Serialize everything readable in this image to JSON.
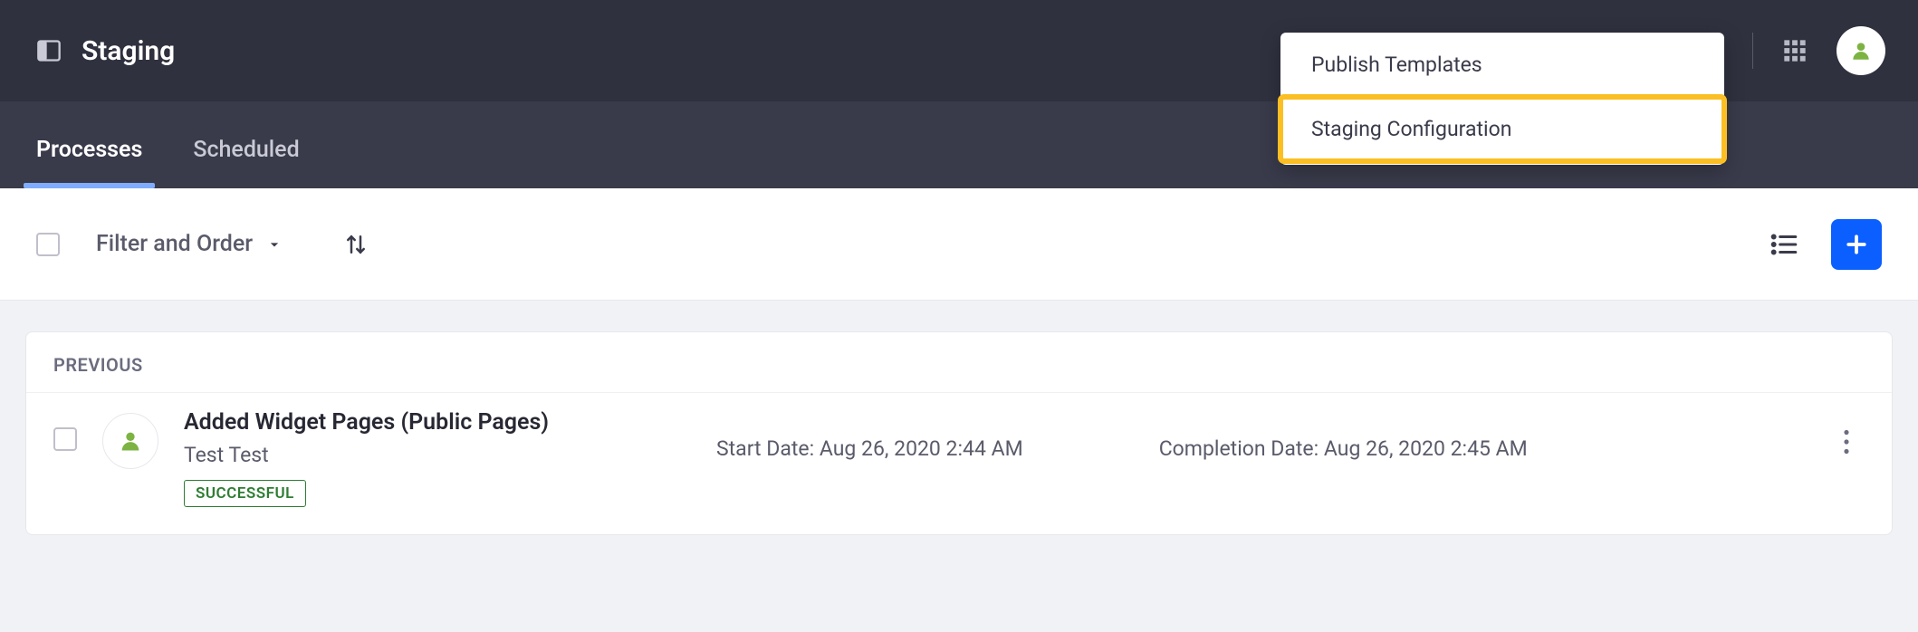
{
  "header": {
    "title": "Staging"
  },
  "dropdown": {
    "items": [
      {
        "label": "Publish Templates",
        "highlighted": false
      },
      {
        "label": "Staging Configuration",
        "highlighted": true
      }
    ]
  },
  "tabs": [
    {
      "label": "Processes",
      "active": true
    },
    {
      "label": "Scheduled",
      "active": false
    }
  ],
  "toolbar": {
    "filter_label": "Filter and Order"
  },
  "panel": {
    "header": "PREVIOUS",
    "rows": [
      {
        "title": "Added Widget Pages (Public Pages)",
        "author": "Test Test",
        "status": "SUCCESSFUL",
        "start_label": "Start Date: Aug 26, 2020 2:44 AM",
        "completion_label": "Completion Date: Aug 26, 2020 2:45 AM"
      }
    ]
  },
  "colors": {
    "accent": "#0b5fff",
    "highlight": "#fbbf24",
    "success": "#2e7d32"
  }
}
